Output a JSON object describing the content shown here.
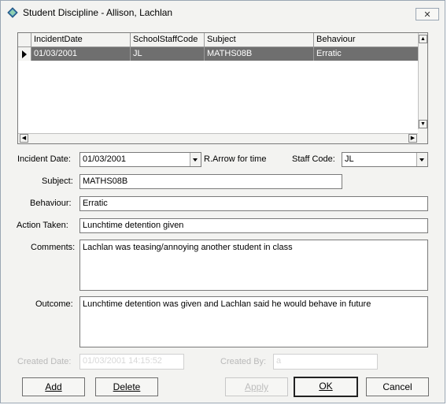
{
  "window": {
    "title": "Student Discipline - Allison, Lachlan",
    "close_label": "✕"
  },
  "grid": {
    "columns": [
      "IncidentDate",
      "SchoolStaffCode",
      "Subject",
      "Behaviour"
    ],
    "rows": [
      [
        "01/03/2001",
        "JL",
        "MATHS08B",
        "Erratic"
      ]
    ]
  },
  "form": {
    "incident_date": {
      "label": "Incident Date:",
      "value": "01/03/2001"
    },
    "arrow_hint": "R.Arrow for time",
    "staff_code": {
      "label": "Staff Code:",
      "value": "JL"
    },
    "subject": {
      "label": "Subject:",
      "value": "MATHS08B"
    },
    "behaviour": {
      "label": "Behaviour:",
      "value": "Erratic"
    },
    "action_taken": {
      "label": "Action Taken:",
      "value": "Lunchtime detention given"
    },
    "comments": {
      "label": "Comments:",
      "value": "Lachlan was teasing/annoying another student in class"
    },
    "outcome": {
      "label": "Outcome:",
      "value": "Lunchtime detention was given and Lachlan said he would behave in future"
    },
    "created_date": {
      "label": "Created Date:",
      "value": "01/03/2001 14:15:52"
    },
    "created_by": {
      "label": "Created By:",
      "value": "a"
    }
  },
  "buttons": {
    "add": "Add",
    "delete": "Delete",
    "apply": "Apply",
    "ok": "OK",
    "cancel": "Cancel"
  }
}
